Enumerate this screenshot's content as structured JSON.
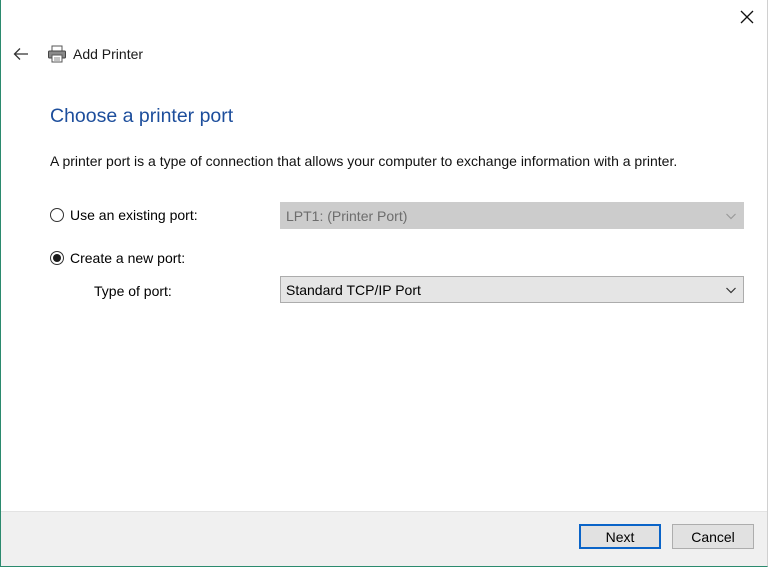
{
  "window": {
    "title": "Add Printer",
    "close_label": "×"
  },
  "icons": {
    "back": "back-arrow-icon",
    "printer": "printer-icon",
    "close": "close-icon",
    "chevron": "chevron-down-icon"
  },
  "page": {
    "heading": "Choose a printer port",
    "description": "A printer port is a type of connection that allows your computer to exchange information with a printer."
  },
  "options": {
    "existing_port": {
      "label": "Use an existing port:",
      "selected": false,
      "value": "LPT1: (Printer Port)",
      "disabled": true
    },
    "new_port": {
      "label": "Create a new port:",
      "selected": true,
      "type_label": "Type of port:",
      "value": "Standard TCP/IP Port"
    }
  },
  "footer": {
    "next_label": "Next",
    "cancel_label": "Cancel"
  },
  "colors": {
    "heading": "#1d4e9c",
    "accent": "#0a64c8",
    "window_border": "#2b8a6e"
  }
}
